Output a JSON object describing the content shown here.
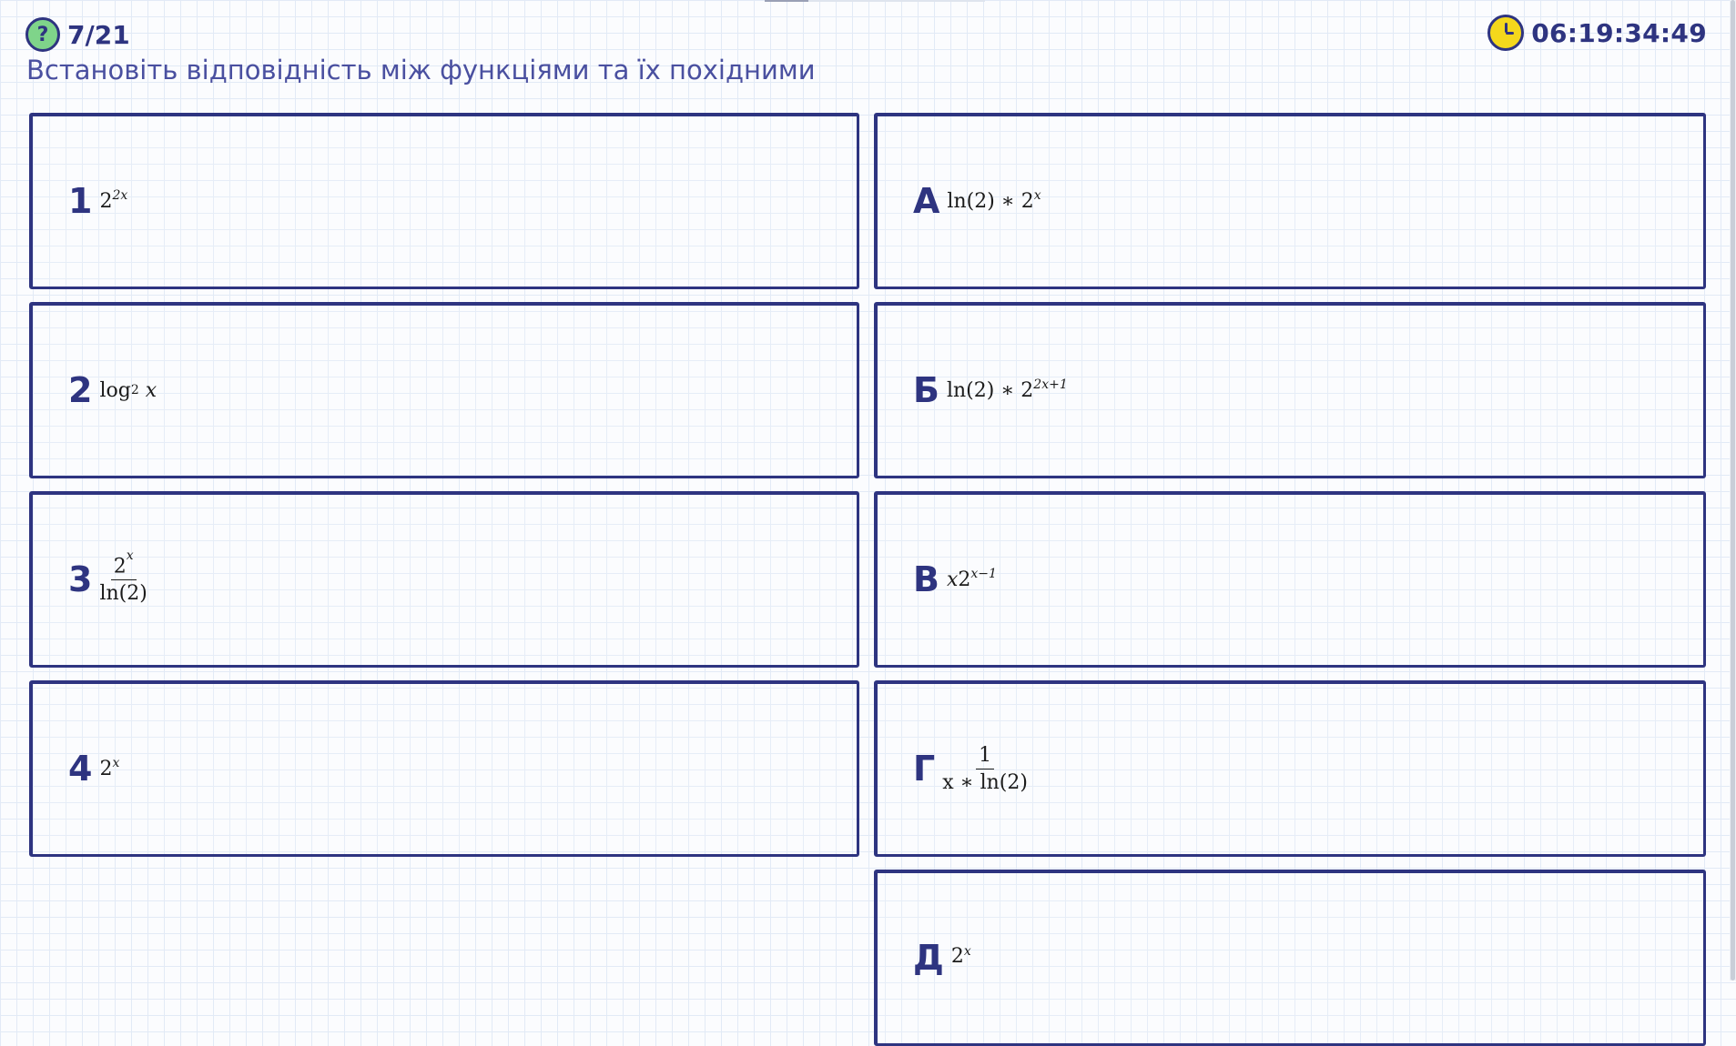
{
  "header": {
    "counter": "7/21",
    "timer": "06:19:34:49",
    "help_icon": "question-mark-icon",
    "clock_icon": "clock-icon"
  },
  "question": "Встановіть відповідність між функціями та їх похідними",
  "left_items": [
    {
      "label": "1",
      "expr": {
        "base": "2",
        "sup": "2x"
      }
    },
    {
      "label": "2",
      "expr": {
        "text": "log",
        "sub": "2",
        "var": "x"
      }
    },
    {
      "label": "3",
      "expr": {
        "num_base": "2",
        "num_sup": "x",
        "den": "ln(2)"
      }
    },
    {
      "label": "4",
      "expr": {
        "base": "2",
        "sup": "x"
      }
    }
  ],
  "right_items": [
    {
      "label": "А",
      "expr": {
        "pre": "ln(2) ∗ 2",
        "sup": "x"
      }
    },
    {
      "label": "Б",
      "expr": {
        "pre": "ln(2) ∗ 2",
        "sup": "2x+1"
      }
    },
    {
      "label": "В",
      "expr": {
        "pre_var": "x",
        "pre": "2",
        "sup": "x−1"
      }
    },
    {
      "label": "Г",
      "expr": {
        "num": "1",
        "den": "x ∗ ln(2)"
      }
    },
    {
      "label": "Д",
      "expr": {
        "base": "2",
        "sup": "x"
      }
    }
  ],
  "colors": {
    "accent": "#2e3480",
    "help": "#7fd48a",
    "clock": "#f4d81c"
  }
}
